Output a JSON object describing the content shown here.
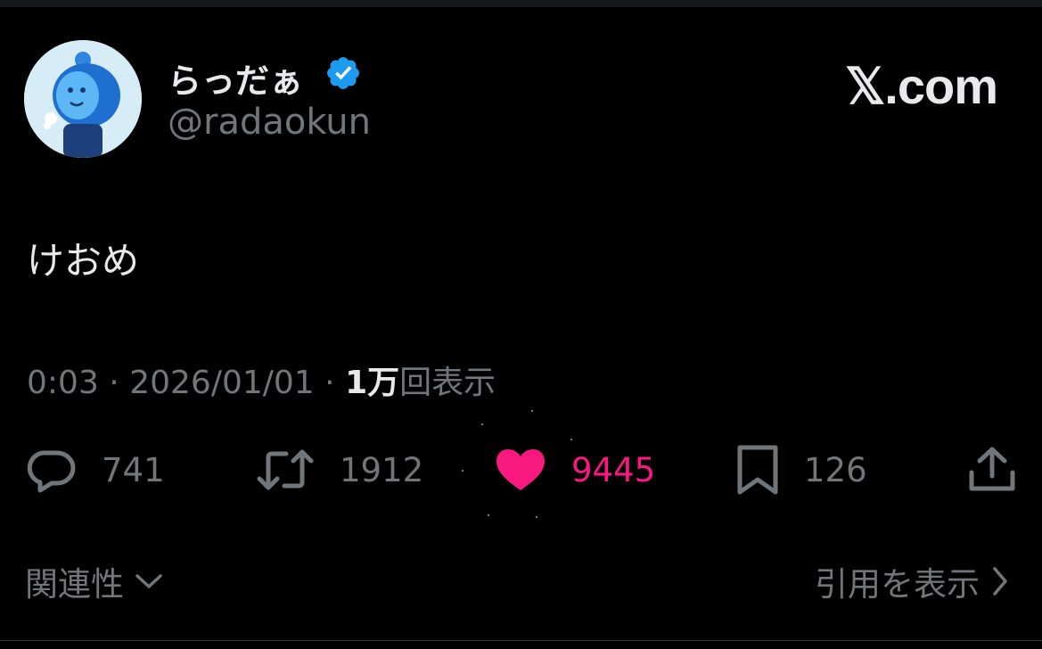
{
  "author": {
    "display_name": "らっだぁ",
    "handle": "@radaokun",
    "verified": true,
    "verified_icon": "verified-badge-icon",
    "avatar_icon": "avatar-image"
  },
  "brand": {
    "site_label": "𝕏.com"
  },
  "tweet": {
    "text": "けおめ"
  },
  "meta": {
    "time": "0:03",
    "separator": "·",
    "date": "2026/01/01",
    "views_count": "1万",
    "views_label": "回表示"
  },
  "actions": {
    "reply": {
      "icon": "reply-icon",
      "count": "741"
    },
    "retweet": {
      "icon": "retweet-icon",
      "count": "1912"
    },
    "like": {
      "icon": "heart-icon",
      "count": "9445",
      "liked": true
    },
    "bookmark": {
      "icon": "bookmark-icon",
      "count": "126"
    },
    "share": {
      "icon": "share-icon"
    }
  },
  "footer": {
    "related_label": "関連性",
    "quotes_label": "引用を表示"
  },
  "colors": {
    "background": "#000000",
    "text_primary": "#e7e9ea",
    "text_secondary": "#71767b",
    "verified_blue": "#1d9bf0",
    "like_pink": "#f91880"
  }
}
